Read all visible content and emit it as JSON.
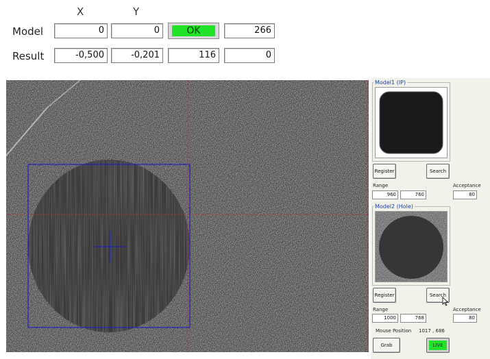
{
  "header": {
    "x_label": "X",
    "y_label": "Y"
  },
  "model_row": {
    "label": "Model",
    "x": "0",
    "y": "0",
    "status": "OK",
    "value": "266"
  },
  "result_row": {
    "label": "Result",
    "x": "-0,500",
    "y": "-0,201",
    "score": "116",
    "value": "0"
  },
  "panel": {
    "model1_title": "Model1 (IP)",
    "model2_title": "Model2 (Hole)",
    "register_label": "Register",
    "search_label": "Search",
    "range_label": "Range",
    "acceptance_label": "Acceptance",
    "model1_range": [
      "960",
      "760"
    ],
    "model1_acceptance": "80",
    "model2_range": [
      "1000",
      "768"
    ],
    "model2_acceptance": "80",
    "mouse_position_label": "Mouse Position",
    "mouse_position_value": "1017 , 686",
    "grab_label": "Grab",
    "live_label": "LIVE"
  },
  "colors": {
    "ok_green": "#22e22a",
    "live_green": "#22e22a",
    "overlay_blue": "#2020c0",
    "crosshair_red": "#c03030"
  }
}
